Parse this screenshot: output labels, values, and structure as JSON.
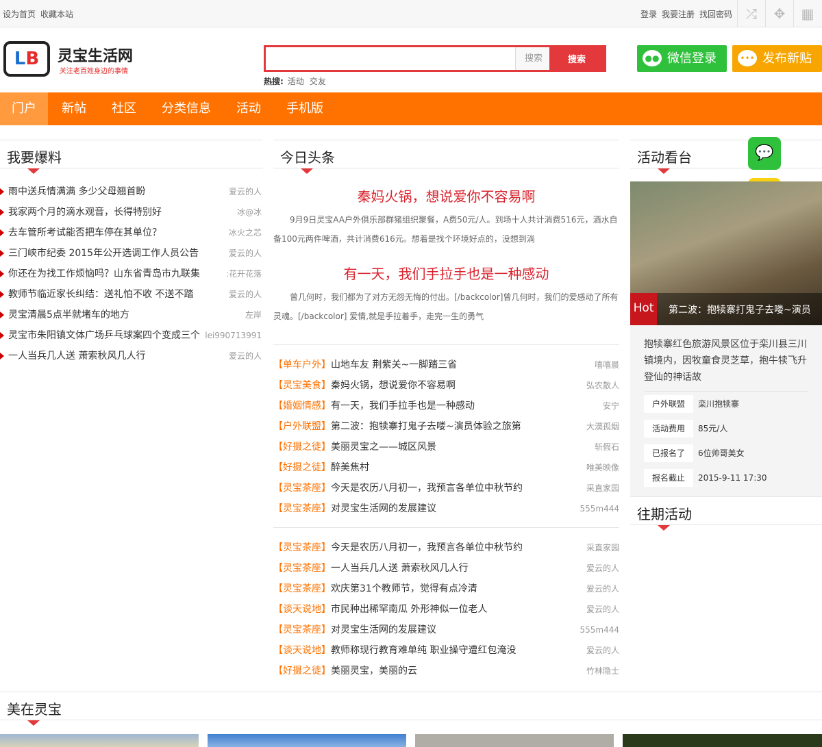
{
  "topbar": {
    "left": [
      "设为首页",
      "收藏本站"
    ],
    "right": [
      "登录",
      "我要注册",
      "找回密码"
    ],
    "icons": [
      "shuffle-icon",
      "move-icon",
      "grid-icon"
    ]
  },
  "logo": {
    "mark": "LB",
    "name": "灵宝生活网",
    "slogan": "关注老百姓身边的事情"
  },
  "search": {
    "value": "",
    "placeholder": "搜索",
    "button": "搜索",
    "hot_label": "热搜:",
    "hot": [
      "活动",
      "交友"
    ]
  },
  "buttons": {
    "wechat_login": "微信登录",
    "post_new": "发布新贴"
  },
  "colors": {
    "nav": "#ff7200",
    "accent": "#e4393c",
    "wechat": "#2fc13b",
    "post": "#f8a500"
  },
  "nav": [
    "门户",
    "新帖",
    "社区",
    "分类信息",
    "活动",
    "手机版"
  ],
  "left": {
    "title": "我要爆料",
    "items": [
      {
        "t": "雨中送兵情满满 多少父母翘首盼",
        "a": "爱云的人"
      },
      {
        "t": "我家两个月的滴水观音，长得特别好",
        "a": "冰@冰"
      },
      {
        "t": "去车管所考试能否把车停在其单位？",
        "a": "冰火之芯"
      },
      {
        "t": "三门峡市纪委 2015年公开选调工作人员公告",
        "a": "爱云的人"
      },
      {
        "t": "你还在为找工作烦恼吗？山东省青岛市九联集",
        "a": ":花开花落"
      },
      {
        "t": "教师节临近家长纠结：送礼怕不收 不送不踏",
        "a": "爱云的人"
      },
      {
        "t": "灵宝清晨5点半就堵车的地方",
        "a": "左岸"
      },
      {
        "t": "灵宝市朱阳镇文体广场乒乓球案四个变成三个",
        "a": "lei990713991"
      },
      {
        "t": "一人当兵几人送 萧索秋风几人行",
        "a": "爱云的人"
      }
    ]
  },
  "middle": {
    "title": "今日头条",
    "headlines": [
      {
        "title": "秦妈火锅，想说爱你不容易啊",
        "summary": "9月9日灵宝AA户外俱乐部群猪组织聚餐，A费50元/人。到场十人共计消费516元，酒水自备100元两件啤酒，共计消费616元。想着是找个环境好点的，没想到淌"
      },
      {
        "title": "有一天，我们手拉手也是一种感动",
        "summary": "曾几何时，我们都为了对方无怨无悔的付出。[/backcolor]曾几何时，我们的爱感动了所有灵魂。[/backcolor] 爱情,就是手拉着手，走完一生的勇气"
      }
    ],
    "list1": [
      {
        "c": "【单车户外】",
        "t": "山地车友 荆紫关~一脚踏三省",
        "a": "嘻嘻晨"
      },
      {
        "c": "【灵宝美食】",
        "t": "秦妈火锅，想说爱你不容易啊",
        "a": "弘农散人"
      },
      {
        "c": "【婚姻情感】",
        "t": "有一天，我们手拉手也是一种感动",
        "a": "安宁"
      },
      {
        "c": "【户外联盟】",
        "t": "第二波：抱犊寨打鬼子去喽~演员体验之旅第",
        "a": "大漠孤烟"
      },
      {
        "c": "【好摄之徒】",
        "t": "美丽灵宝之——城区风景",
        "a": "斩假石"
      },
      {
        "c": "【好摄之徒】",
        "t": "醉美焦村",
        "a": "唯美映像"
      },
      {
        "c": "【灵宝茶座】",
        "t": "今天是农历八月初一，我预言各单位中秋节约",
        "a": "采直家园"
      },
      {
        "c": "【灵宝茶座】",
        "t": "对灵宝生活网的发展建议",
        "a": "555m444"
      }
    ],
    "list2": [
      {
        "c": "【灵宝茶座】",
        "t": "今天是农历八月初一，我预言各单位中秋节约",
        "a": "采直家园"
      },
      {
        "c": "【灵宝茶座】",
        "t": "一人当兵几人送 萧索秋风几人行",
        "a": "爱云的人"
      },
      {
        "c": "【灵宝茶座】",
        "t": "欢庆第31个教师节，觉得有点冷清",
        "a": "爱云的人"
      },
      {
        "c": "【谈天说地】",
        "t": "市民种出稀罕南瓜 外形神似一位老人",
        "a": "爱云的人"
      },
      {
        "c": "【灵宝茶座】",
        "t": "对灵宝生活网的发展建议",
        "a": "555m444"
      },
      {
        "c": "【谈天说地】",
        "t": "教师称现行教育难单纯 职业操守遭红包淹没",
        "a": "爱云的人"
      },
      {
        "c": "【好摄之徒】",
        "t": "美丽灵宝，美丽的云",
        "a": "竹林隐士"
      }
    ]
  },
  "right": {
    "title": "活动看台",
    "hot": "Hot",
    "caption": "第二波：抱犊寨打鬼子去喽~演员",
    "desc": "抱犊寨红色旅游风景区位于栾川县三川镇境内，因牧童食灵芝草，抱牛犊飞升登仙的神话故",
    "info": [
      {
        "k": "户外联盟",
        "v": "栾川抱犊寨"
      },
      {
        "k": "活动费用",
        "v": "85元/人"
      },
      {
        "k": "已报名了",
        "v": "6位帅哥美女"
      },
      {
        "k": "报名截止",
        "v": "2015-9-11 17:30"
      }
    ],
    "past_title": "往期活动"
  },
  "bottom": {
    "title": "美在灵宝"
  }
}
